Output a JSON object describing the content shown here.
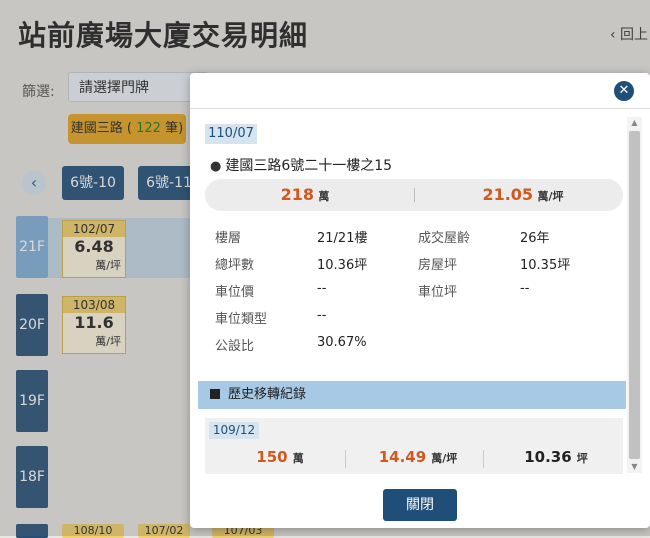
{
  "page": {
    "title": "站前廣場大廈交易明細",
    "back_label": "‹ 回上",
    "filter_label": "篩選:",
    "select_placeholder": "請選擇門牌",
    "road_chip_prefix": "建國三路 ( ",
    "road_chip_count": "122",
    "road_chip_suffix": " 筆)",
    "door_tabs": [
      "6號-10",
      "6號-11"
    ],
    "floors": [
      "21F",
      "20F",
      "19F",
      "18F"
    ],
    "tx_cards": [
      {
        "date": "102/07",
        "price": "6.48",
        "unit": "萬/坪"
      },
      {
        "date": "103/08",
        "price": "11.6",
        "unit": "萬/坪"
      }
    ],
    "bottom_chips": [
      "108/10",
      "107/02",
      "107/03"
    ]
  },
  "modal": {
    "date": "110/07",
    "address": "建國三路6號二十一樓之15",
    "total_price": "218",
    "total_unit": "萬",
    "unit_price": "21.05",
    "unit_price_unit": "萬/坪",
    "details": {
      "floor_k": "樓層",
      "floor_v": "21/21樓",
      "age_k": "成交屋齡",
      "age_v": "26年",
      "area_k": "總坪數",
      "area_v": "10.36坪",
      "house_k": "房屋坪",
      "house_v": "10.35坪",
      "park_price_k": "車位價",
      "park_price_v": "--",
      "park_area_k": "車位坪",
      "park_area_v": "--",
      "park_type_k": "車位類型",
      "park_type_v": "--",
      "public_k": "公設比",
      "public_v": "30.67%"
    },
    "history_title": "歷史移轉紀錄",
    "history": [
      {
        "date": "109/12",
        "price": "150",
        "price_unit": "萬",
        "unit_price": "14.49",
        "unit_price_unit": "萬/坪",
        "area": "10.36",
        "area_unit": "坪"
      }
    ],
    "close_label": "關閉"
  }
}
